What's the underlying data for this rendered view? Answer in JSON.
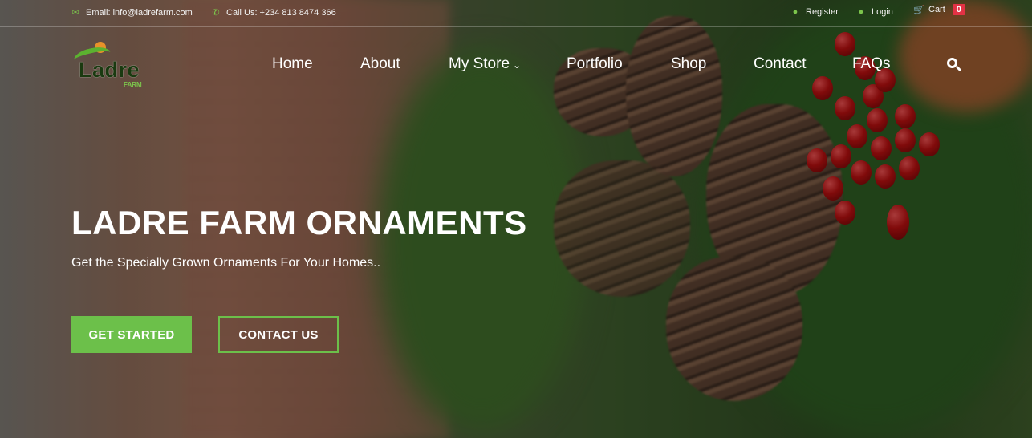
{
  "topbar": {
    "email": "Email: info@ladrefarm.com",
    "phone": "Call Us: +234 813 8474 366",
    "register": "Register",
    "login": "Login",
    "cart": "Cart",
    "cart_count": "0"
  },
  "logo": {
    "word": "Ladre",
    "sub": "FARM"
  },
  "nav": {
    "home": "Home",
    "about": "About",
    "mystore": "My Store",
    "portfolio": "Portfolio",
    "shop": "Shop",
    "contact": "Contact",
    "faqs": "FAQs"
  },
  "hero": {
    "title": "LADRE FARM ORNAMENTS",
    "subtitle": "Get the Specially Grown Ornaments For Your Homes..",
    "primary_button": "GET STARTED",
    "secondary_button": "CONTACT US"
  },
  "colors": {
    "accent": "#6cc04a",
    "badge": "#e33245"
  }
}
